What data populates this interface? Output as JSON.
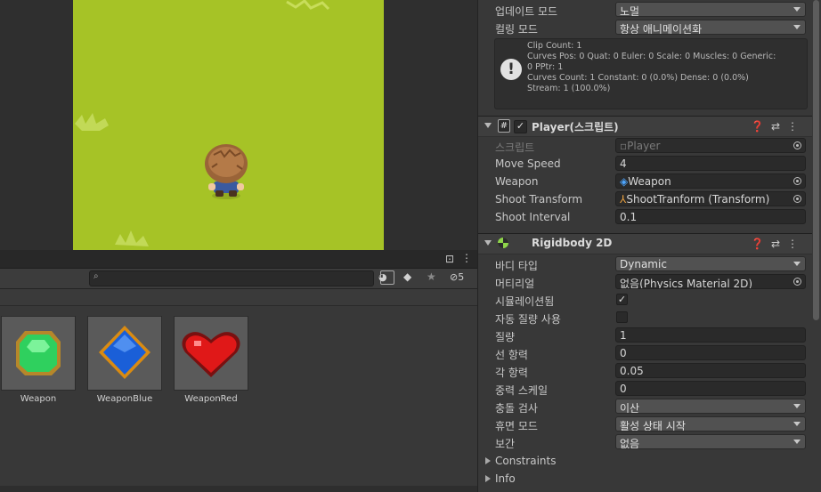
{
  "project": {
    "assets": [
      {
        "name": "Weapon",
        "color": "#2fd05e",
        "border": "#b6872a",
        "shape": "octagon"
      },
      {
        "name": "WeaponBlue",
        "color": "#1a5fd8",
        "border": "#d98b12",
        "shape": "diamond"
      },
      {
        "name": "WeaponRed",
        "color": "#e01818",
        "border": "#7a1010",
        "shape": "heart"
      }
    ],
    "hidden_count": "5"
  },
  "inspector": {
    "animator": {
      "update_mode_label": "업데이트 모드",
      "update_mode_value": "노멀",
      "culling_mode_label": "컬링 모드",
      "culling_mode_value": "항상 애니메이션화",
      "clip_info": [
        "Clip Count: 1",
        "Curves Pos: 0 Quat: 0 Euler: 0 Scale: 0 Muscles: 0 Generic:",
        "0 PPtr: 1",
        "Curves Count: 1 Constant: 0 (0.0%) Dense: 0 (0.0%)",
        "Stream: 1 (100.0%)"
      ]
    },
    "player": {
      "title": "Player(스크립트)",
      "script_label": "스크립트",
      "script_value": "Player",
      "move_speed_label": "Move Speed",
      "move_speed_value": "4",
      "weapon_label": "Weapon",
      "weapon_value": "Weapon",
      "shoot_transform_label": "Shoot Transform",
      "shoot_transform_value": "ShootTranform (Transform)",
      "shoot_interval_label": "Shoot Interval",
      "shoot_interval_value": "0.1"
    },
    "rigidbody": {
      "title": "Rigidbody 2D",
      "body_type_label": "바디 타입",
      "body_type_value": "Dynamic",
      "material_label": "머티리얼",
      "material_value": "없음(Physics Material 2D)",
      "simulated_label": "시뮬레이션됨",
      "simulated_checked": true,
      "auto_mass_label": "자동 질량 사용",
      "auto_mass_checked": false,
      "mass_label": "질량",
      "mass_value": "1",
      "linear_drag_label": "선 항력",
      "linear_drag_value": "0",
      "angular_drag_label": "각 항력",
      "angular_drag_value": "0.05",
      "gravity_scale_label": "중력 스케일",
      "gravity_scale_value": "0",
      "collision_label": "충돌 검사",
      "collision_value": "이산",
      "sleep_label": "휴면 모드",
      "sleep_value": "활성 상태 시작",
      "interpolate_label": "보간",
      "interpolate_value": "없음",
      "constraints_label": "Constraints",
      "info_label": "Info"
    }
  }
}
